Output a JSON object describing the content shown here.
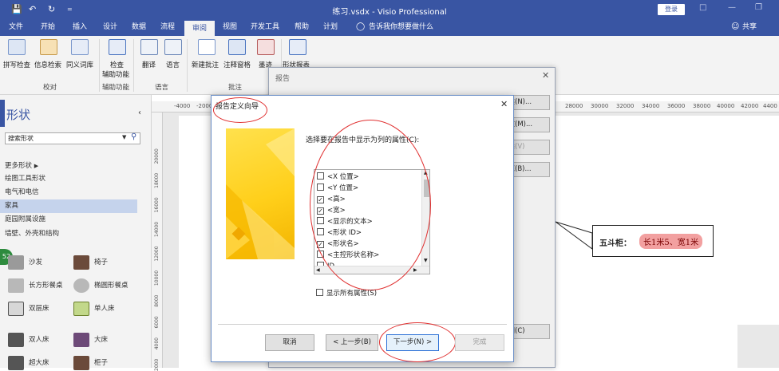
{
  "titlebar": {
    "title": "练习.vsdx  -  Visio Professional",
    "signin": "登录",
    "save_icon": "save-icon",
    "undo_icon": "undo-icon",
    "redo_icon": "redo-icon"
  },
  "tabs": [
    "文件",
    "开始",
    "插入",
    "设计",
    "数据",
    "流程",
    "审阅",
    "视图",
    "开发工具",
    "帮助",
    "计划"
  ],
  "tell_me": "告诉我你想要做什么",
  "share": "共享",
  "ribbon": {
    "groups": {
      "proofing": "校对",
      "accessibility": "辅助功能",
      "language": "语言",
      "comments": "批注"
    },
    "items": {
      "spelling": "拼写检查",
      "info_search": "信息检索",
      "thesaurus": "同义词库",
      "check_line1": "检查",
      "check_line2": "辅助功能",
      "translate": "翻译",
      "language": "语言",
      "new_comment": "新建批注",
      "comment_pane": "注释窗格",
      "ink": "墨迹",
      "shape_report": "形状报表"
    }
  },
  "shapes_pane": {
    "title": "形状",
    "search_placeholder": "搜索形状",
    "categories": [
      "更多形状",
      "绘图工具形状",
      "电气和电信",
      "家具",
      "庭园附属设施",
      "墙壁、外壳和结构"
    ],
    "selected_index": 3,
    "items": [
      [
        "沙发",
        "椅子"
      ],
      [
        "长方形餐桌",
        "椭圆形餐桌"
      ],
      [
        "双层床",
        "单人床"
      ],
      [
        "双人床",
        "大床"
      ],
      [
        "超大床",
        "柜子"
      ]
    ],
    "badge": "52"
  },
  "ruler": {
    "left_ticks": [
      "-4000",
      "-2000"
    ],
    "right_ticks": [
      "28000",
      "30000",
      "32000",
      "34000",
      "36000",
      "38000",
      "40000",
      "42000",
      "4400"
    ],
    "vertical_ticks": [
      "20000",
      "18000",
      "16000",
      "14000",
      "12000",
      "10000",
      "8000",
      "6000",
      "4000",
      "2000"
    ]
  },
  "callout": {
    "label": "五斗柜：",
    "value": "长1米5、宽1米"
  },
  "report_dialog": {
    "title": "报告",
    "buttons": [
      "新建(N)...",
      "修改(M)...",
      "删除(V)",
      "浏览(B)..."
    ],
    "close": "关闭(C)"
  },
  "wizard": {
    "title": "报告定义向导",
    "prompt": "选择要在报告中显示为列的属性(C):",
    "properties": [
      {
        "label": "<X 位置>",
        "checked": false
      },
      {
        "label": "<Y 位置>",
        "checked": false
      },
      {
        "label": "<高>",
        "checked": true
      },
      {
        "label": "<宽>",
        "checked": true
      },
      {
        "label": "<显示的文本>",
        "checked": false
      },
      {
        "label": "<形状 ID>",
        "checked": false
      },
      {
        "label": "<形状名>",
        "checked": true
      },
      {
        "label": "<主控形状名称>",
        "checked": false
      },
      {
        "label": "ID",
        "checked": false
      }
    ],
    "show_all": "显示所有属性(S)",
    "cancel": "取消",
    "back": "< 上一步(B)",
    "next": "下一步(N) >",
    "finish": "完成"
  },
  "colors": {
    "accent": "#3955a3",
    "annotation": "#e03030",
    "highlight": "#f2a0a0"
  }
}
